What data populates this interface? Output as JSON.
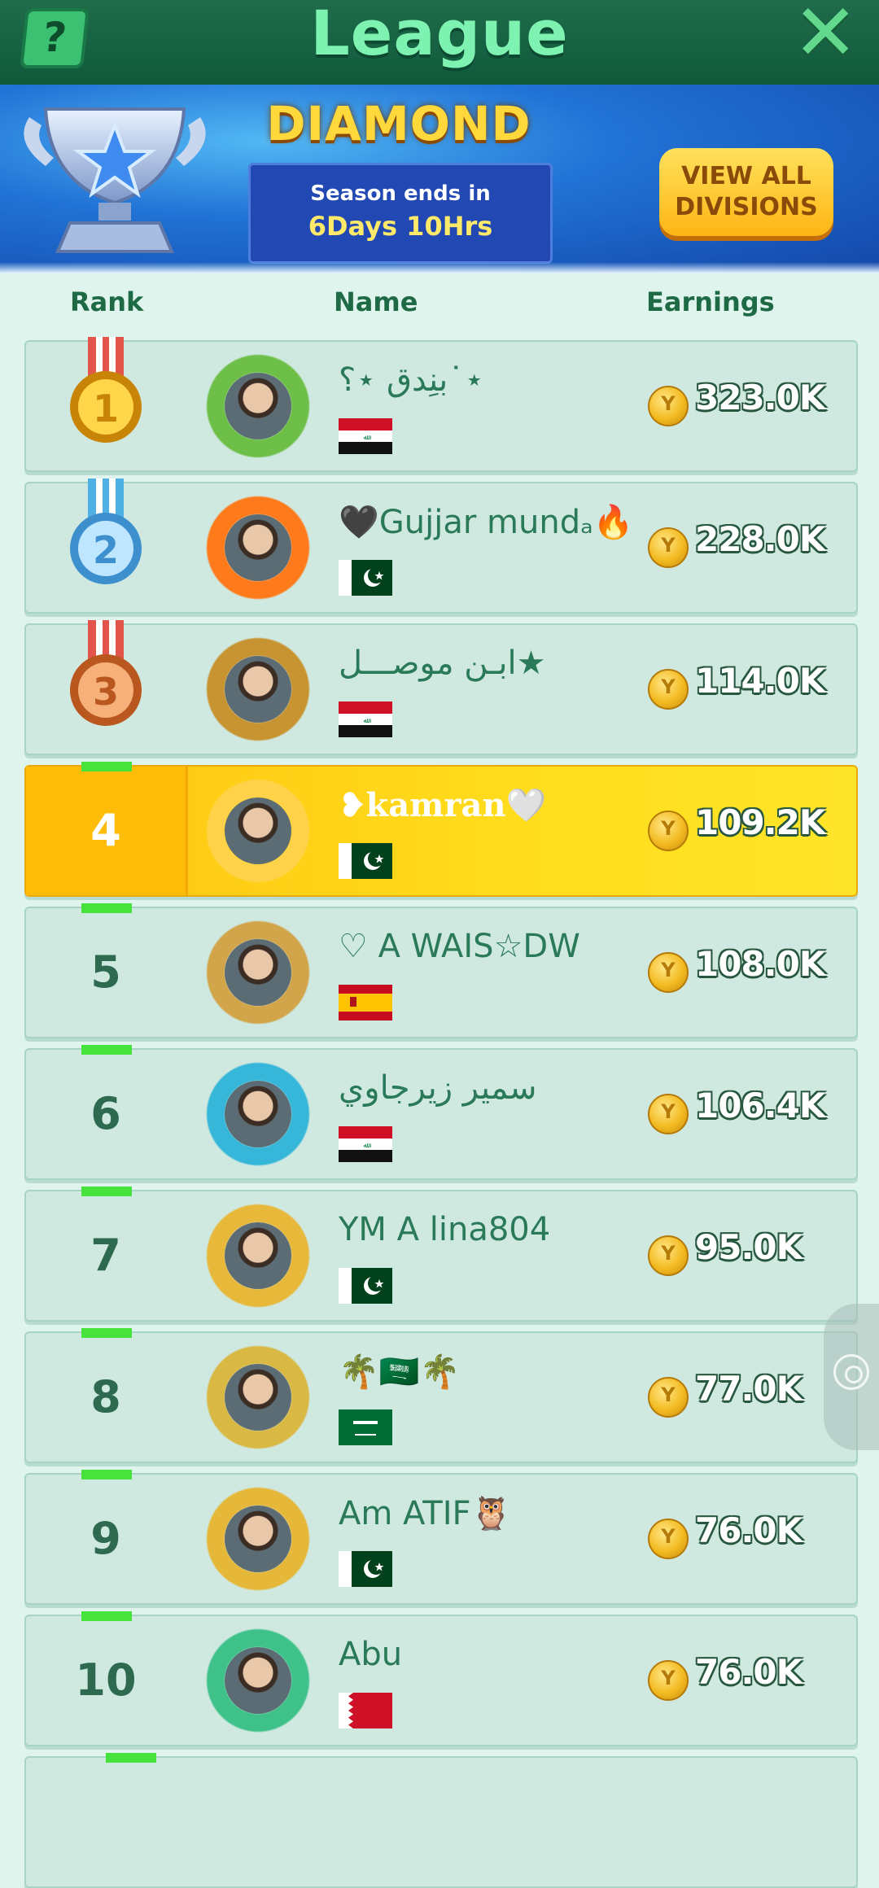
{
  "header": {
    "title": "League",
    "help_icon": "help-question-icon",
    "close_icon": "close-icon",
    "colors": {
      "bar": "#17613f",
      "title": "#7ef2b0"
    }
  },
  "banner": {
    "league": "DIAMOND",
    "season_label": "Season ends in",
    "season_time": "6Days 10Hrs",
    "view_all_line1": "VIEW ALL",
    "view_all_line2": "DIVISIONS",
    "trophy_icon": "diamond-trophy-icon"
  },
  "columns": {
    "rank": "Rank",
    "name": "Name",
    "earnings": "Earnings"
  },
  "rows": [
    {
      "rank": "1",
      "name": "بنِدق ⋆؟˙⋆",
      "flag": "iraq",
      "earnings": "323.0K",
      "medal": "gold"
    },
    {
      "rank": "2",
      "name": "🖤Gujjar mundₐ🔥",
      "flag": "pakistan",
      "earnings": "228.0K",
      "medal": "silver"
    },
    {
      "rank": "3",
      "name": "ابـن موصـــل★",
      "flag": "iraq",
      "earnings": "114.0K",
      "medal": "bronze"
    },
    {
      "rank": "4",
      "name": "❥kamran🤍",
      "flag": "pakistan",
      "earnings": "109.2K",
      "current_user": true
    },
    {
      "rank": "5",
      "name": "♡ A WAIS☆DW",
      "flag": "spain",
      "earnings": "108.0K"
    },
    {
      "rank": "6",
      "name": "سمير زيرجاوي",
      "flag": "iraq",
      "earnings": "106.4K"
    },
    {
      "rank": "7",
      "name": "YM A lina804",
      "flag": "pakistan",
      "earnings": "95.0K"
    },
    {
      "rank": "8",
      "name": "🌴🇸🇦🌴",
      "flag": "saudi",
      "earnings": "77.0K"
    },
    {
      "rank": "9",
      "name": "Am ATIF🦉",
      "flag": "pakistan",
      "earnings": "76.0K"
    },
    {
      "rank": "10",
      "name": "Abu",
      "flag": "bahrain",
      "earnings": "76.0K"
    }
  ],
  "coin_icon": "coin-icon"
}
